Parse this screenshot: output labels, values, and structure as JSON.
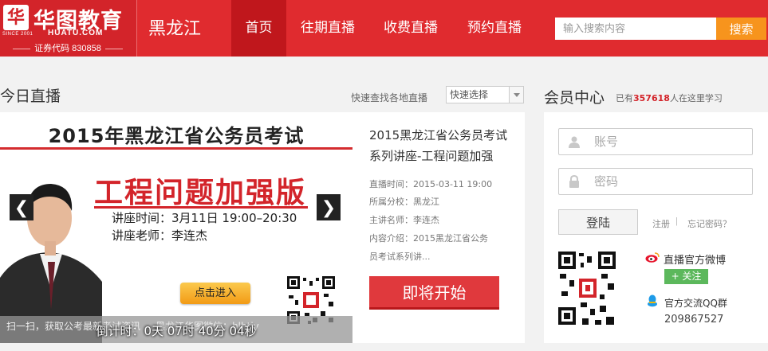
{
  "brand": {
    "mark": "华",
    "since": "SINCE 2001",
    "name": "华图教育",
    "url": "HUATU.COM",
    "stock": "证券代码 830858",
    "region": "黑龙江"
  },
  "nav": {
    "items": [
      {
        "label": "首页",
        "active": true
      },
      {
        "label": "往期直播",
        "active": false
      },
      {
        "label": "收费直播",
        "active": false
      },
      {
        "label": "预约直播",
        "active": false
      }
    ]
  },
  "search": {
    "placeholder": "输入搜索内容",
    "button_label": "搜索"
  },
  "today": {
    "title": "今日直播",
    "quick_label": "快速查找各地直播",
    "quick_select": "快速选择"
  },
  "banner": {
    "title": "2015年黑龙江省公务员考试",
    "headline": "工程问题加强版",
    "time_line": "讲座时间：3月11日 19:00–20:30",
    "teacher_line": "讲座老师：李连杰",
    "enter_label": "点击进入",
    "prev_arrow": "❮",
    "next_arrow": "❯",
    "strip_text": "扫一扫，获取公考最新考试资讯 ... 黑龙江华图微信：hlhtjy",
    "countdown": "倒计时：0天 07时 40分 04秒"
  },
  "course": {
    "title": "2015黑龙江省公务员考试系列讲座-工程问题加强",
    "live_time": "直播时间：2015-03-11 19:00",
    "branch": "所属分校：黑龙江",
    "speaker": "主讲名师：李连杰",
    "intro_1": "内容介绍：2015黑龙江省公务",
    "intro_2": "员考试系列讲...",
    "start_label": "即将开始"
  },
  "member": {
    "title": "会员中心",
    "sub_prefix": "已有",
    "count": "357618",
    "sub_suffix": "人在这里学习",
    "account_placeholder": "账号",
    "password_placeholder": "密码",
    "login_label": "登陆",
    "register_label": "注册",
    "separator": "|",
    "forgot_label": "忘记密码？",
    "weibo_label": "直播官方微博",
    "follow_label": "+ 关注",
    "qq_label": "官方交流QQ群",
    "qq_number": "209867527"
  },
  "colors": {
    "brand_red": "#e02b2f",
    "nav_active": "#c0171c",
    "search_orange": "#f7941d",
    "follow_green": "#5cb85c"
  },
  "icons": [
    "user-icon",
    "lock-icon",
    "weibo-icon",
    "qq-icon",
    "qr-code"
  ]
}
